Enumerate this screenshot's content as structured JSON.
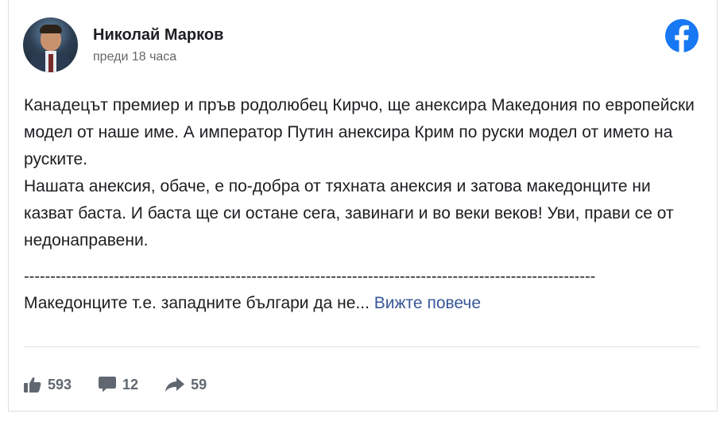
{
  "post": {
    "author": "Николай Марков",
    "time": "преди 18 часа",
    "paragraphs": [
      "Канадецът премиер и пръв родолюбец Кирчо, ще анексира Македония по европейски модел от наше име. А император Путин анексира Крим по руски модел от името на руските.",
      "Нашата анексия, обаче, е по-добра от тяхната анексия и затова македонците ни казват баста. И баста ще си остане сега, завинаги и во веки веков! Уви, прави се от недонаправени."
    ],
    "separator": "------------------------------------------------------------------------------------------------------------",
    "truncated_text": "Македонците т.е. западните българи да не...",
    "see_more_label": "Вижте повече"
  },
  "platform_icon": "facebook-logo-icon",
  "colors": {
    "facebook_blue": "#1877f2",
    "link": "#385898",
    "secondary_text": "#65676b"
  },
  "stats": {
    "likes": "593",
    "comments": "12",
    "shares": "59",
    "icons": [
      "thumbs-up-icon",
      "comment-icon",
      "share-icon"
    ]
  }
}
